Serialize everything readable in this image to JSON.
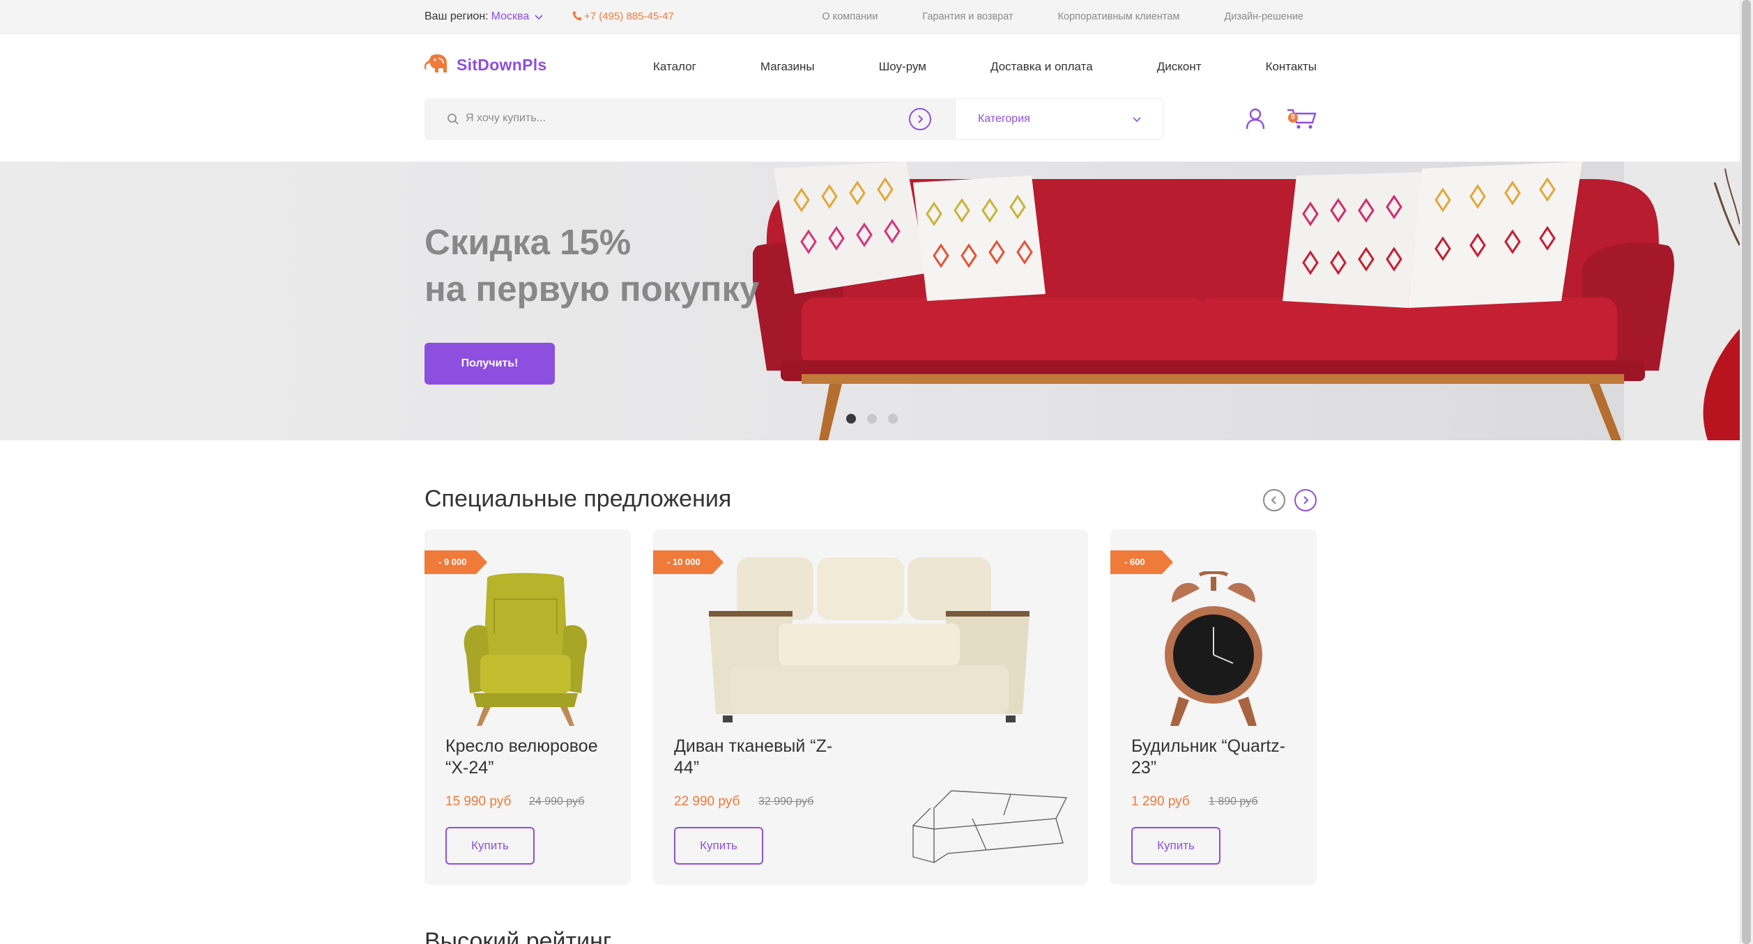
{
  "topbar": {
    "region_label": "Ваш регион:",
    "region_city": "Москва",
    "phone": "+7 (495) 885-45-47",
    "links": [
      "О компании",
      "Гарантия и возврат",
      "Корпоративным клиентам",
      "Дизайн-решение"
    ]
  },
  "header": {
    "logo_text": "SitDownPls",
    "nav": [
      "Каталог",
      "Магазины",
      "Шоу-рум",
      "Доставка и оплата",
      "Дисконт",
      "Контакты"
    ],
    "search_placeholder": "Я хочу купить...",
    "category_label": "Категория",
    "cart_count": "0"
  },
  "hero": {
    "title_line1": "Скидка 15%",
    "title_line2": "на первую покупку",
    "button_label": "Получить!",
    "slides": 3,
    "active_slide": 1
  },
  "specials": {
    "title": "Специальные предложения",
    "items": [
      {
        "badge": "- 9 000",
        "name_line1": "Кресло велюровое",
        "name_line2": "“X-24”",
        "price": "15 990 руб",
        "old_price": "24 990 руб",
        "buy_label": "Купить"
      },
      {
        "badge": "- 10 000",
        "name_line1": "Диван тканевый “Z-",
        "name_line2": "44”",
        "price": "22 990 руб",
        "old_price": "32 990 руб",
        "buy_label": "Купить"
      },
      {
        "badge": "- 600",
        "name_line1": "Будильник “Quartz-",
        "name_line2": "23”",
        "price": "1 290 руб",
        "old_price": "1 890 руб",
        "buy_label": "Купить"
      }
    ]
  },
  "next_section_title": "Высокий рейтинг",
  "colors": {
    "accent": "#8d4fe0",
    "orange": "#f07a3a",
    "sofa_red": "#b81c2e"
  }
}
